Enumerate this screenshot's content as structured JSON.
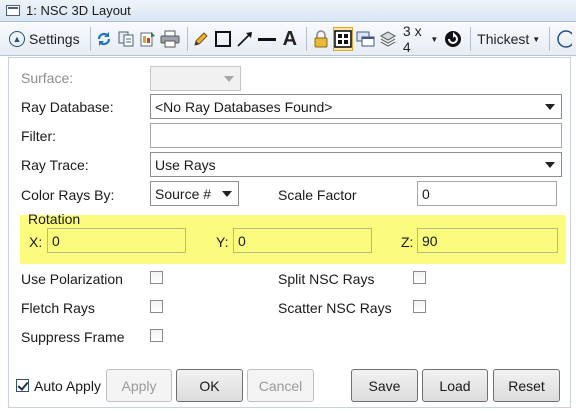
{
  "window": {
    "title": "1: NSC 3D Layout"
  },
  "toolbar": {
    "settings_label": "Settings",
    "layout_label": "3 x 4",
    "thickness_label": "Thickest"
  },
  "form": {
    "surface_label": "Surface:",
    "surface_value": "",
    "ray_database_label": "Ray Database:",
    "ray_database_value": "<No Ray Databases Found>",
    "filter_label": "Filter:",
    "filter_value": "",
    "ray_trace_label": "Ray Trace:",
    "ray_trace_value": "Use Rays",
    "color_rays_by_label": "Color Rays By:",
    "color_rays_by_value": "Source #",
    "scale_factor_label": "Scale Factor",
    "scale_factor_value": "0"
  },
  "rotation": {
    "title": "Rotation",
    "x_label": "X:",
    "x_value": "0",
    "y_label": "Y:",
    "y_value": "0",
    "z_label": "Z:",
    "z_value": "90"
  },
  "options": {
    "use_polarization": {
      "label": "Use Polarization",
      "checked": false
    },
    "split_nsc_rays": {
      "label": "Split NSC Rays",
      "checked": false
    },
    "fletch_rays": {
      "label": "Fletch Rays",
      "checked": false
    },
    "scatter_nsc_rays": {
      "label": "Scatter NSC Rays",
      "checked": false
    },
    "suppress_frame": {
      "label": "Suppress Frame",
      "checked": false
    }
  },
  "footer": {
    "auto_apply_label": "Auto Apply",
    "auto_apply_checked": true,
    "apply_label": "Apply",
    "ok_label": "OK",
    "cancel_label": "Cancel",
    "save_label": "Save",
    "load_label": "Load",
    "reset_label": "Reset"
  },
  "colors": {
    "rotation_highlight": "#fbfb7e",
    "active_tool_highlight": "#fbe5a8",
    "title_bar": "#dbe6f4"
  },
  "icons": [
    "window-icon",
    "settings-icon",
    "refresh-icon",
    "copy-icon",
    "export-icon",
    "print-icon",
    "pencil-icon",
    "rectangle-icon",
    "arrow-line-icon",
    "line-icon",
    "text-icon",
    "lock-icon",
    "layout-grid-icon",
    "windows-icon",
    "stack-icon",
    "options-icon"
  ]
}
